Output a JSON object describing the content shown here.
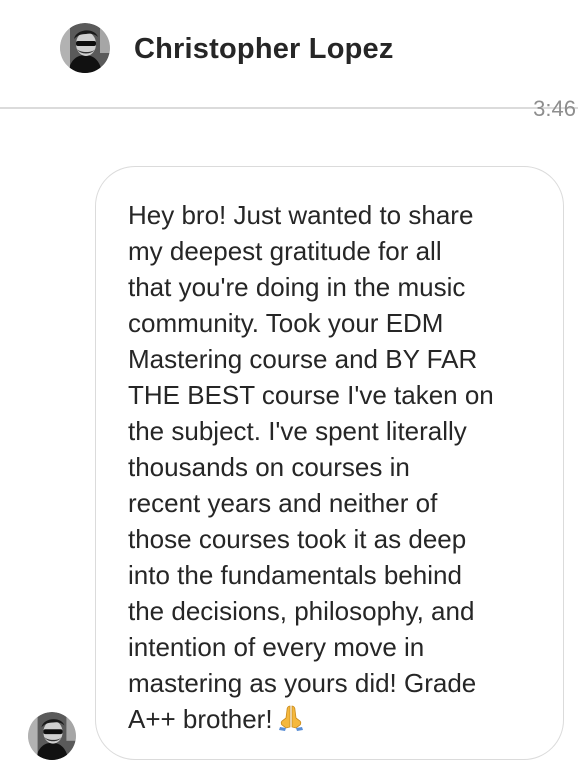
{
  "header": {
    "contact_name": "Christopher Lopez",
    "avatar_icon": "profile-photo-icon"
  },
  "thread": {
    "timestamp": "3:46",
    "messages": [
      {
        "sender": "Christopher Lopez",
        "text": "Hey bro! Just wanted to share\nmy deepest gratitude for all\nthat you're doing in the music\ncommunity. Took your EDM\nMastering course and BY FAR\nTHE BEST course I've taken on\nthe subject. I've spent literally\nthousands on courses in\nrecent years and neither of\nthose courses took it as deep\ninto the fundamentals behind\nthe decisions, philosophy, and\nintention of every move in\nmastering as yours did! Grade\nA++ brother!",
        "emoji": "folded-hands-icon"
      }
    ]
  },
  "colors": {
    "text_primary": "#262626",
    "text_secondary": "#8e8e8e",
    "border": "#dbdbdb",
    "emoji_skin": "#f5b83d"
  }
}
